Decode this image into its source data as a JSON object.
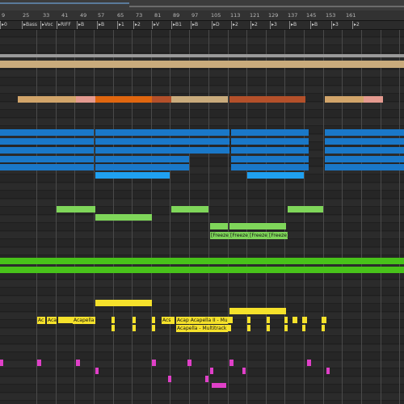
{
  "ruler": {
    "bars": [
      "9",
      "25",
      "33",
      "41",
      "49",
      "57",
      "65",
      "73",
      "81",
      "89",
      "97",
      "105",
      "113",
      "121",
      "129",
      "137",
      "145",
      "153",
      "161"
    ]
  },
  "locators": [
    "0",
    "Bass",
    "Voc",
    "RIFF",
    "B",
    "B",
    "1",
    "2",
    "V",
    "B1",
    "B",
    "D",
    "2",
    "2",
    "3",
    "B",
    "B",
    "3",
    "2"
  ],
  "colors": {
    "background": "#262626",
    "grid": "#4a4a4a",
    "orange": "#e0660f",
    "tan": "#d2a56a",
    "rust": "#b4502a",
    "pink": "#e49a8f",
    "beige": "#c9ab7c",
    "blue": "#1a78c8",
    "light_blue": "#1fa0f0",
    "light_green": "#7fd65a",
    "green": "#48c21a",
    "yellow": "#f5e12b",
    "magenta": "#e040c8"
  },
  "clips": {
    "freeze_1": "[Freeze]",
    "freeze_2": "[Freeze]",
    "freeze_3": "[Freeze]",
    "freeze_4": "[Freeze]",
    "acapella_main": "Acapella",
    "acapella_bottom": "Acapella - Multitrack",
    "acapella_top": "Acap Acapella II - Multit",
    "ac": "Ac",
    "aca": "Aca",
    "acs": "Acs"
  }
}
